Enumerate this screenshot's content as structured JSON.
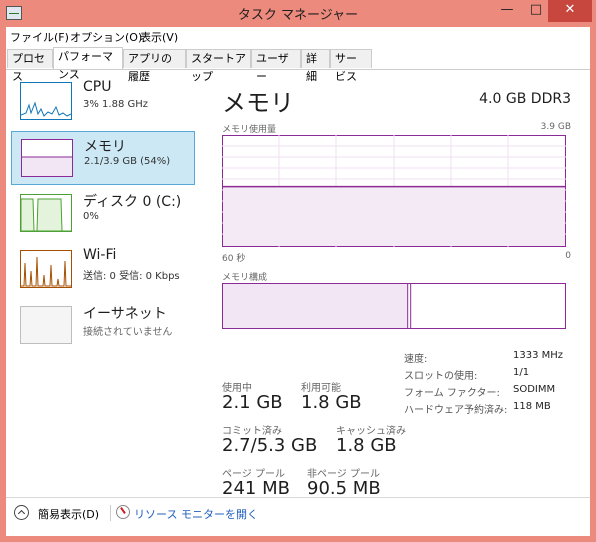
{
  "window": {
    "title": "タスク マネージャー",
    "min_glyph": "—",
    "max_glyph": "□",
    "close_glyph": "✕"
  },
  "menu": [
    {
      "label": "ファイル(F)"
    },
    {
      "label": "オプション(O)"
    },
    {
      "label": "表示(V)"
    }
  ],
  "tabs": [
    {
      "label": "プロセス"
    },
    {
      "label": "パフォーマンス",
      "active": true
    },
    {
      "label": "アプリの履歴"
    },
    {
      "label": "スタートアップ"
    },
    {
      "label": "ユーザー"
    },
    {
      "label": "詳細"
    },
    {
      "label": "サービス"
    }
  ],
  "sidebar": [
    {
      "name": "CPU",
      "sub": "3% 1.88 GHz",
      "color": "#1176b8"
    },
    {
      "name": "メモリ",
      "sub": "2.1/3.9 GB (54%)",
      "color": "#8b2a97",
      "selected": true
    },
    {
      "name": "ディスク 0 (C:)",
      "sub": "0%",
      "color": "#4da033"
    },
    {
      "name": "Wi-Fi",
      "sub": "送信: 0 受信: 0 Kbps",
      "color": "#a74f00"
    },
    {
      "name": "イーサネット",
      "sub": "接続されていません",
      "color": "#a0a0a0"
    }
  ],
  "main": {
    "title": "メモリ",
    "spec": "4.0 GB DDR3",
    "usage_label": "メモリ使用量",
    "usage_max": "3.9 GB",
    "time_left": "60 秒",
    "time_right": "0",
    "composition_label": "メモリ構成",
    "usage_fraction": 0.54,
    "composition_fraction": 0.54,
    "accent": "#8b2a97"
  },
  "stats": {
    "in_use_label": "使用中",
    "in_use": "2.1 GB",
    "available_label": "利用可能",
    "available": "1.8 GB",
    "committed_label": "コミット済み",
    "committed": "2.7/5.3 GB",
    "cached_label": "キャッシュ済み",
    "cached": "1.8 GB",
    "paged_label": "ページ プール",
    "paged": "241 MB",
    "nonpaged_label": "非ページ プール",
    "nonpaged": "90.5 MB"
  },
  "specs": [
    {
      "k": "速度:",
      "v": "1333 MHz"
    },
    {
      "k": "スロットの使用:",
      "v": "1/1"
    },
    {
      "k": "フォーム ファクター:",
      "v": "SODIMM"
    },
    {
      "k": "ハードウェア予約済み:",
      "v": "118 MB"
    }
  ],
  "footer": {
    "fewer_details": "簡易表示(D)",
    "resource_monitor": "リソース モニターを開く"
  }
}
